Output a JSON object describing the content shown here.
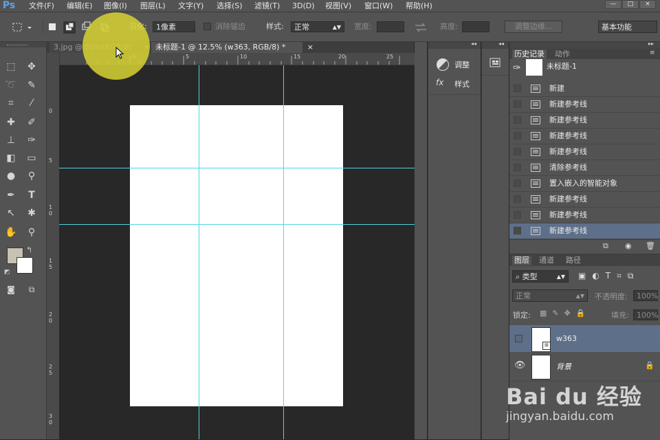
{
  "app": {
    "logo": "Ps"
  },
  "menu": [
    "文件(F)",
    "编辑(E)",
    "图像(I)",
    "图层(L)",
    "文字(Y)",
    "选择(S)",
    "滤镜(T)",
    "3D(D)",
    "视图(V)",
    "窗口(W)",
    "帮助(H)"
  ],
  "window_controls": [
    "—",
    "□",
    "×"
  ],
  "options": {
    "feather_label": "羽化:",
    "feather_value": "1像素",
    "antialias_label": "消除锯齿",
    "style_label": "样式:",
    "style_value": "正常",
    "width_label": "宽度:",
    "height_label": "高度:",
    "refine_label": "调整边缘...",
    "workspace": "基本功能"
  },
  "tabs": [
    {
      "label": "3.jpg @ 50%(RGB/8)",
      "close": "×"
    },
    {
      "label": "未标题-1 @ 12.5% (w363, RGB/8) *",
      "close": "×"
    }
  ],
  "ruler": {
    "h": [
      "0",
      "5",
      "10",
      "15",
      "20",
      "25"
    ],
    "v": [
      "0",
      "5",
      "1\n0",
      "1\n5",
      "2\n0",
      "2\n5",
      "3\n0"
    ]
  },
  "side_panel": {
    "adjust_label": "调整",
    "style_label": "样式"
  },
  "history": {
    "tabs": [
      "历史记录",
      "动作"
    ],
    "snapshot": "未标题-1",
    "items": [
      "新建",
      "新建参考线",
      "新建参考线",
      "新建参考线",
      "新建参考线",
      "清除参考线",
      "置入嵌入的智能对象",
      "新建参考线",
      "新建参考线",
      "新建参考线"
    ]
  },
  "layers": {
    "tabs": [
      "图层",
      "通道",
      "路径"
    ],
    "filter": "类型",
    "blend": "正常",
    "opacity_label": "不透明度:",
    "opacity_value": "100%",
    "lock_label": "锁定:",
    "fill_label": "填充:",
    "fill_value": "100%",
    "items": [
      {
        "name": "w363",
        "visible": false,
        "selected": true
      },
      {
        "name": "背景",
        "visible": true,
        "selected": false
      }
    ]
  },
  "watermark": {
    "brand": "Bai du 经验",
    "url": "jingyan.baidu.com"
  },
  "colors": {
    "accent": "#5fa3e8",
    "guide": "#4cd7e8",
    "selection": "#5e6f89",
    "highlight": "#d7d232"
  }
}
